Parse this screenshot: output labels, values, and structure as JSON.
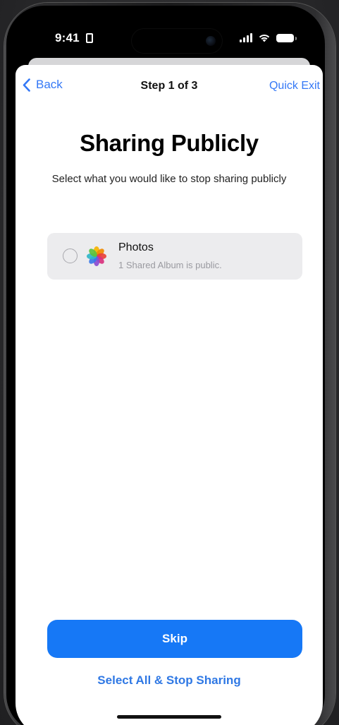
{
  "status_bar": {
    "time": "9:41"
  },
  "nav": {
    "back_label": "Back",
    "step_label": "Step 1 of 3",
    "exit_label": "Quick Exit"
  },
  "page": {
    "title": "Sharing Publicly",
    "subtitle": "Select what you would like to stop sharing publicly"
  },
  "options": [
    {
      "icon": "photos-app-icon",
      "title": "Photos",
      "description": "1 Shared Album is public.",
      "selected": false
    }
  ],
  "actions": {
    "primary_label": "Skip",
    "secondary_label": "Select All & Stop Sharing"
  },
  "colors": {
    "accent": "#1678f6",
    "link": "#3478f6",
    "card_bg": "#ececee"
  }
}
